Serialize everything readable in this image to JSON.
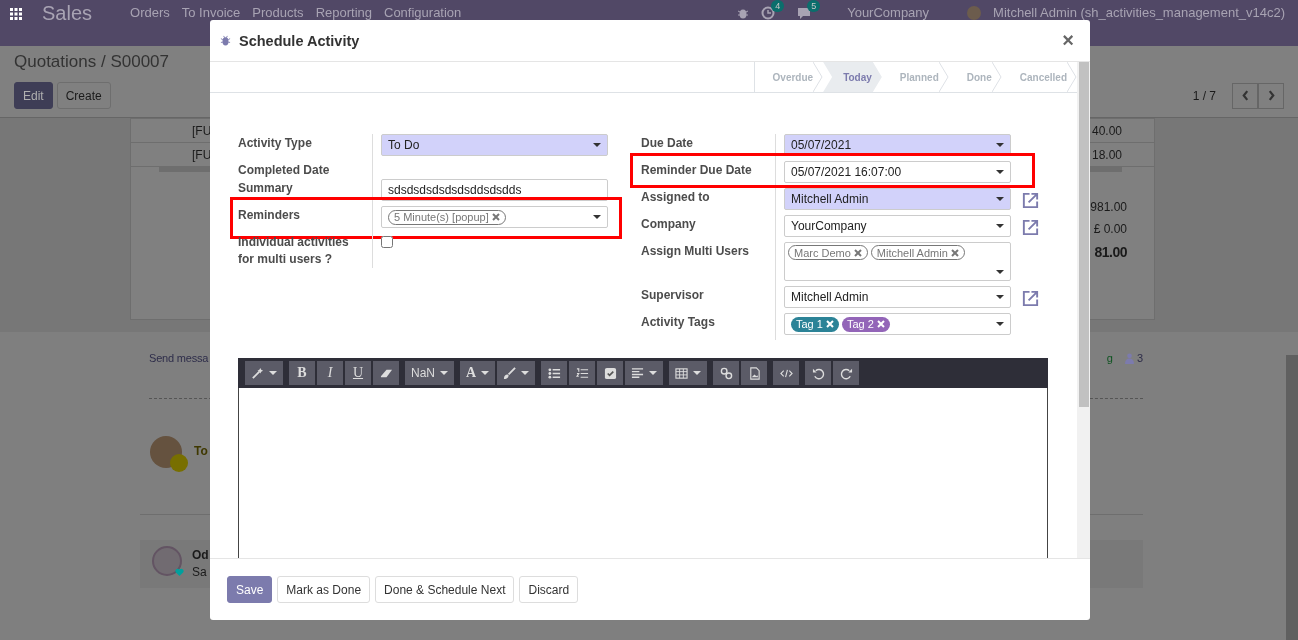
{
  "navbar": {
    "app": "Sales",
    "menu": [
      "Orders",
      "To Invoice",
      "Products",
      "Reporting",
      "Configuration"
    ],
    "activity_count": "4",
    "message_count": "5",
    "company": "YourCompany",
    "user": "Mitchell Admin (sh_activities_management_v14c2)"
  },
  "breadcrumb": "Quotations / S00007",
  "actions": [
    {
      "label": "Edit",
      "primary": true
    },
    {
      "label": "Create",
      "primary": false
    }
  ],
  "pager": "1 / 7",
  "order_lines": [
    {
      "product": "[FU",
      "subtotal": "40.00"
    },
    {
      "product": "[FU",
      "subtotal": "18.00"
    }
  ],
  "totals": [
    {
      "value": "981.00",
      "bold": false
    },
    {
      "value": "£ 0.00",
      "bold": false
    },
    {
      "value": "81.00",
      "bold": true
    }
  ],
  "chatter": {
    "send_message": "Send messa",
    "log_note": "g",
    "followers": "3",
    "message_author": "To",
    "note_author": "Od",
    "note_body": "Sa"
  },
  "dialog": {
    "title": "Schedule Activity",
    "close": "×",
    "stages": [
      {
        "label": "Overdue",
        "selected": false
      },
      {
        "label": "Today",
        "selected": true
      },
      {
        "label": "Planned",
        "selected": false
      },
      {
        "label": "Done",
        "selected": false
      },
      {
        "label": "Cancelled",
        "selected": false
      }
    ],
    "left_fields": [
      {
        "kind": "select",
        "label": "Activity Type",
        "value": "To Do",
        "required": true,
        "highlighted": false
      },
      {
        "kind": "label",
        "label": "Completed Date"
      },
      {
        "kind": "text",
        "label": "Summary",
        "value": "sdsdsdsdsdsdsddsdsdds",
        "required": false,
        "highlighted": false
      },
      {
        "kind": "tags",
        "label": "Reminders",
        "tags": [
          {
            "label": "5 Minute(s) [popup]"
          }
        ],
        "required": false,
        "highlighted": true
      },
      {
        "kind": "checkbox",
        "label": "Individual activities for multi users ?",
        "checked": false
      }
    ],
    "right_fields": [
      {
        "kind": "select",
        "label": "Due Date",
        "value": "05/07/2021",
        "required": true,
        "highlighted": false,
        "external_link": false
      },
      {
        "kind": "select",
        "label": "Reminder Due Date",
        "value": "05/07/2021 16:07:00",
        "required": false,
        "highlighted": true,
        "external_link": false
      },
      {
        "kind": "select",
        "label": "Assigned to",
        "value": "Mitchell Admin",
        "required": true,
        "highlighted": false,
        "external_link": true
      },
      {
        "kind": "select",
        "label": "Company",
        "value": "YourCompany",
        "required": false,
        "highlighted": false,
        "external_link": true
      },
      {
        "kind": "user_tags",
        "label": "Assign Multi Users",
        "tags": [
          {
            "label": "Marc Demo"
          },
          {
            "label": "Mitchell Admin"
          }
        ],
        "required": false,
        "highlighted": false,
        "external_link": false
      },
      {
        "kind": "select",
        "label": "Supervisor",
        "value": "Mitchell Admin",
        "required": false,
        "highlighted": false,
        "external_link": true
      },
      {
        "kind": "tags",
        "label": "Activity Tags",
        "tags": [
          {
            "label": "Tag 1",
            "color": "#2c8397"
          },
          {
            "label": "Tag 2",
            "color": "#9365b8"
          }
        ],
        "required": false,
        "highlighted": false,
        "external_link": false
      }
    ],
    "editor_toolbar": {
      "bold": "B",
      "italic": "I",
      "underline": "U",
      "font_size": "NaN",
      "font_color": "A"
    },
    "buttons": [
      {
        "label": "Save",
        "primary": true
      },
      {
        "label": "Mark as Done",
        "primary": false
      },
      {
        "label": "Done & Schedule Next",
        "primary": false
      },
      {
        "label": "Discard",
        "primary": false
      }
    ]
  }
}
